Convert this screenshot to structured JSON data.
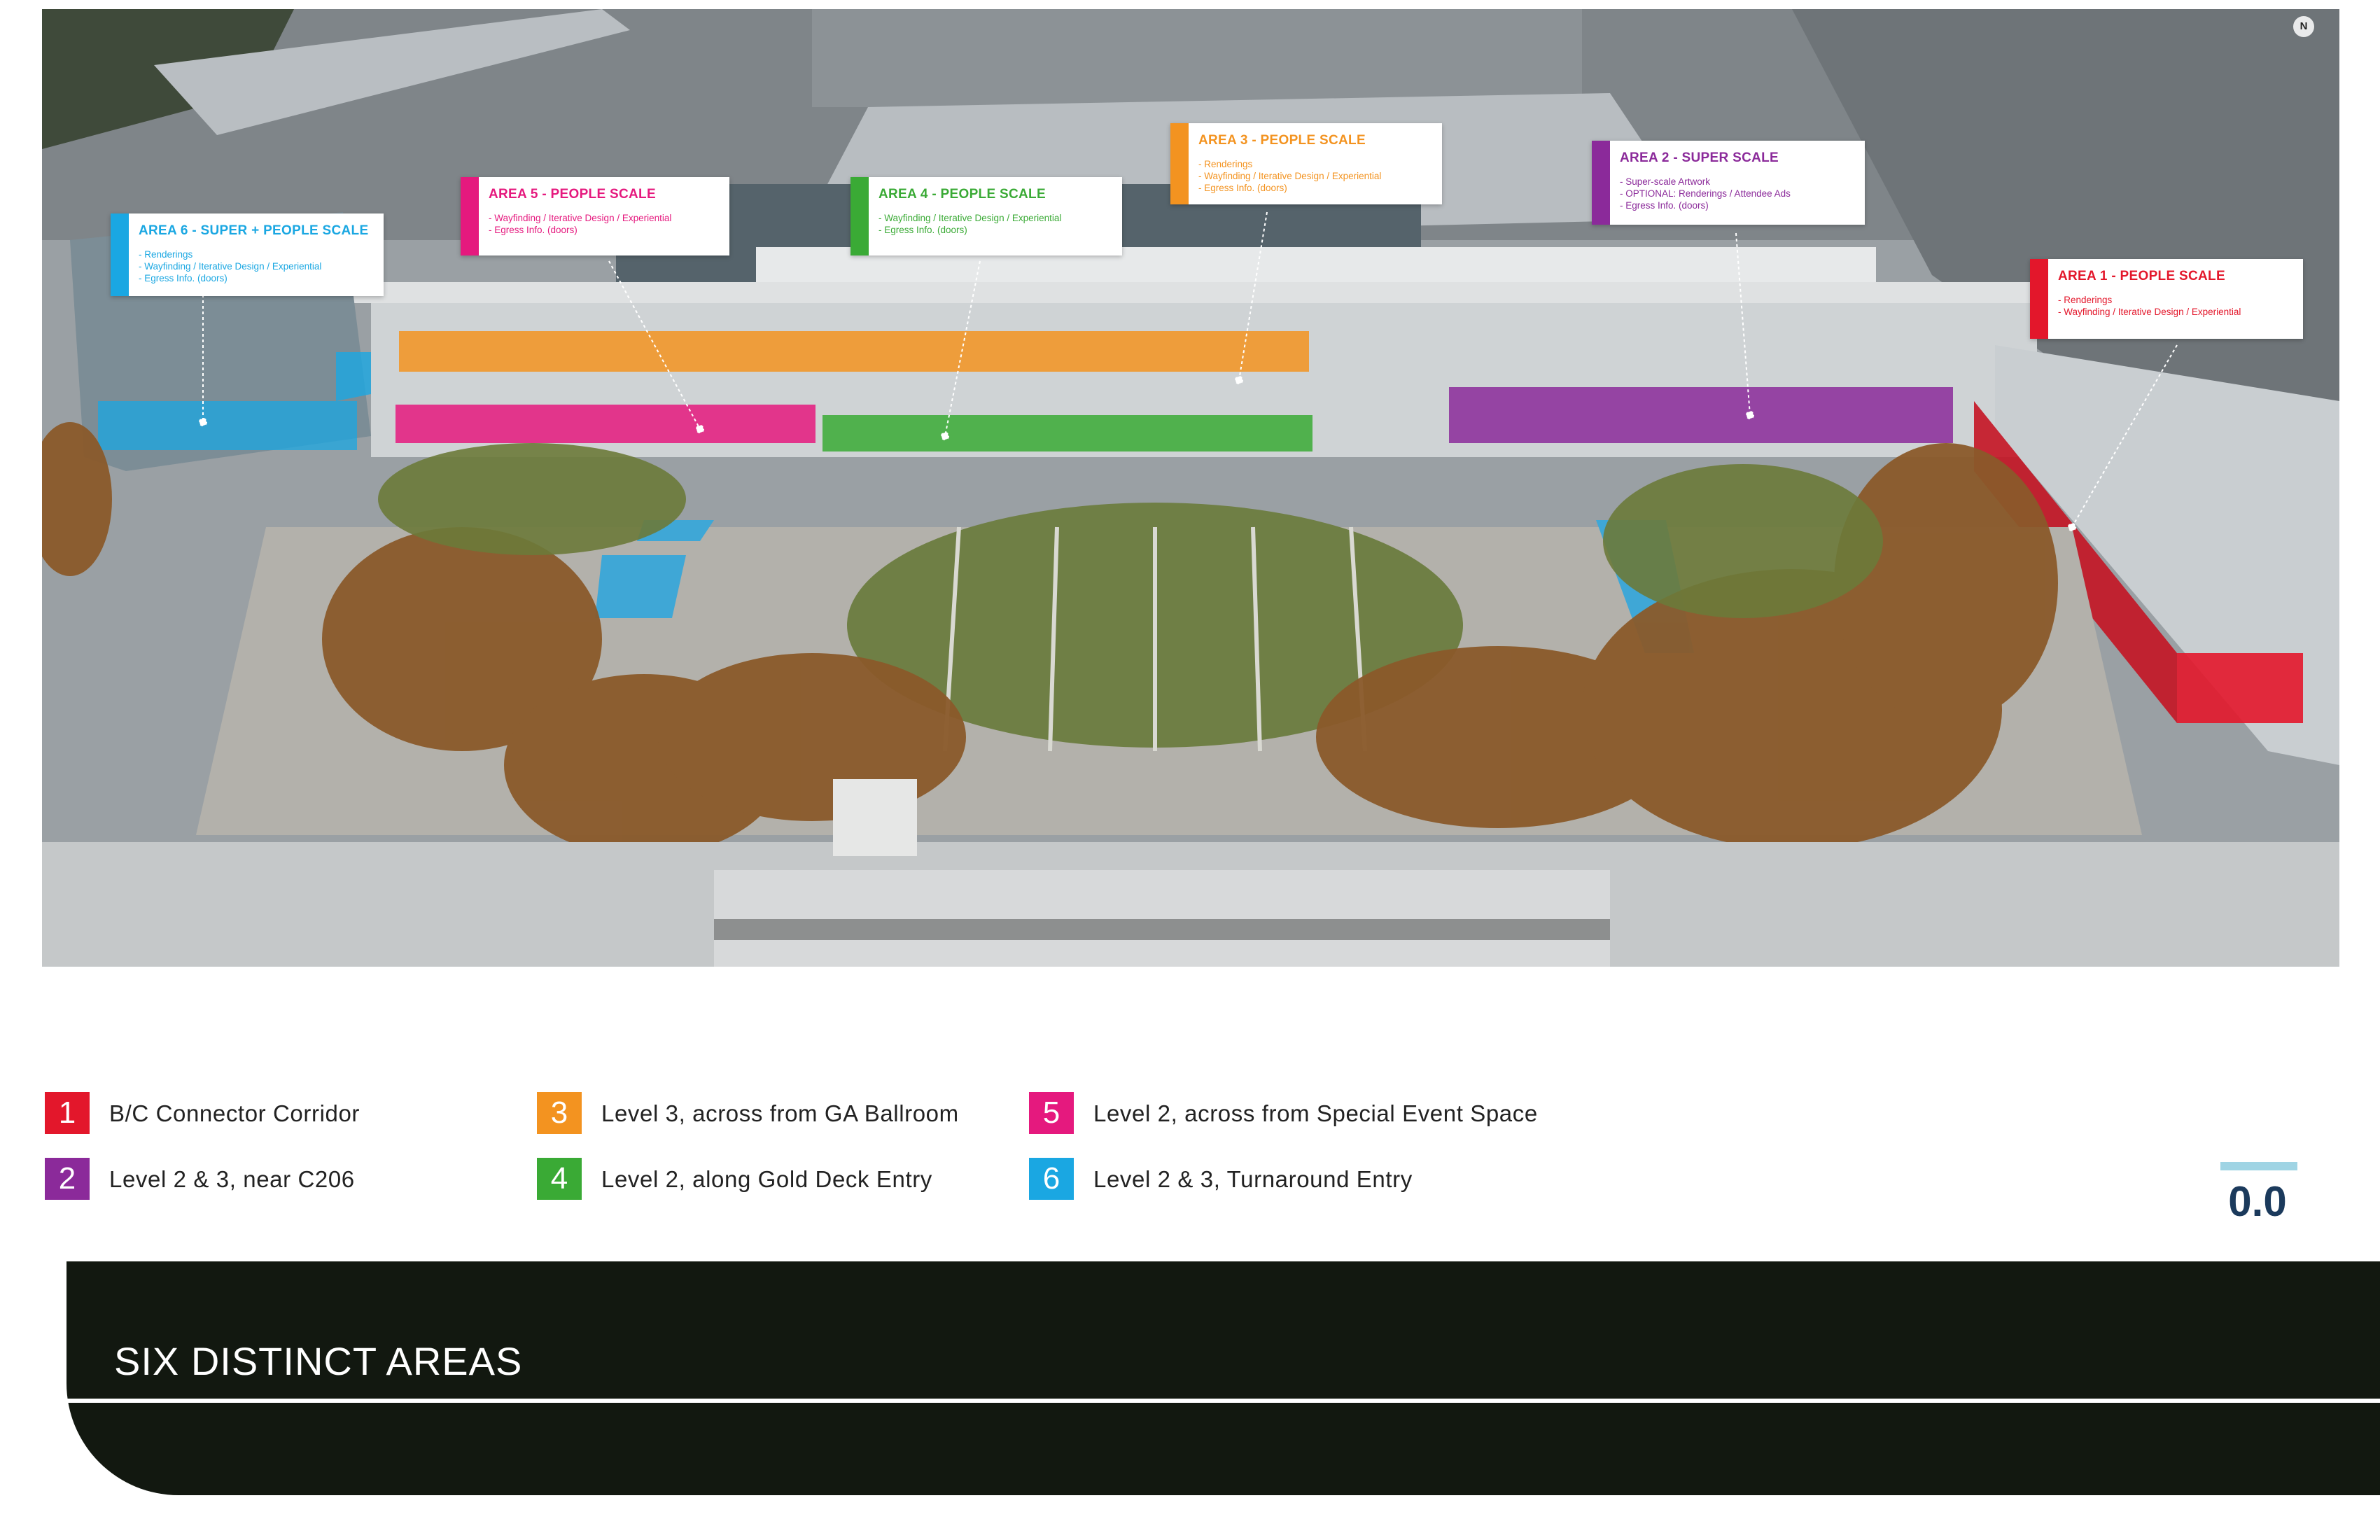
{
  "north_label": "N",
  "colors": {
    "area1": "#e3172b",
    "area2": "#8b2a9a",
    "area3": "#f39320",
    "area4": "#3aaa35",
    "area5": "#e5197e",
    "area6": "#1aa7e2",
    "footer": "#121810",
    "scale_text": "#1b3a5c",
    "scale_bar": "#9fd4e4"
  },
  "callouts": [
    {
      "title": "AREA 6 - SUPER + PEOPLE SCALE",
      "lines": [
        "- Renderings",
        "- Wayfinding / Iterative Design / Experiential",
        "- Egress Info. (doors)"
      ]
    },
    {
      "title": "AREA 5 - PEOPLE SCALE",
      "lines": [
        "- Wayfinding / Iterative Design / Experiential",
        "- Egress Info. (doors)"
      ]
    },
    {
      "title": "AREA 4 - PEOPLE SCALE",
      "lines": [
        "- Wayfinding / Iterative Design / Experiential",
        "- Egress Info. (doors)"
      ]
    },
    {
      "title": "AREA 3 - PEOPLE SCALE",
      "lines": [
        "- Renderings",
        "- Wayfinding / Iterative Design / Experiential",
        "- Egress Info. (doors)"
      ]
    },
    {
      "title": "AREA 2 - SUPER SCALE",
      "lines": [
        "- Super-scale Artwork",
        "- OPTIONAL: Renderings / Attendee Ads",
        "- Egress Info. (doors)"
      ]
    },
    {
      "title": "AREA 1 - PEOPLE SCALE",
      "lines": [
        "- Renderings",
        "- Wayfinding / Iterative Design / Experiential"
      ]
    }
  ],
  "legend": [
    {
      "number": "1",
      "label": "B/C Connector Corridor"
    },
    {
      "number": "2",
      "label": "Level 2 & 3, near C206"
    },
    {
      "number": "3",
      "label": "Level 3, across from GA Ballroom"
    },
    {
      "number": "4",
      "label": "Level 2, along Gold Deck Entry"
    },
    {
      "number": "5",
      "label": "Level 2, across from Special Event Space"
    },
    {
      "number": "6",
      "label": "Level 2 & 3, Turnaround Entry"
    }
  ],
  "scale_value": "0.0",
  "footer_title": "SIX DISTINCT AREAS"
}
